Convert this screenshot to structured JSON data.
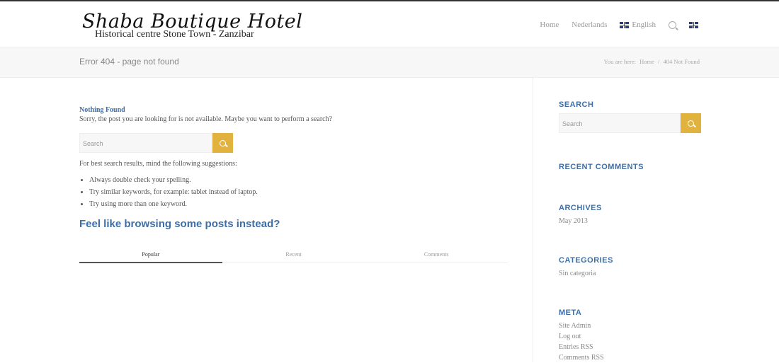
{
  "logo": {
    "title": "Shaba Boutique Hotel",
    "subtitle": "Historical centre Stone Town - Zanzibar"
  },
  "nav": {
    "home": "Home",
    "dutch": "Nederlands",
    "english": "English"
  },
  "titlebar": {
    "title": "Error 404 - page not found",
    "breadcrumb_label": "You are here:",
    "breadcrumb_home": "Home",
    "breadcrumb_sep": "/",
    "breadcrumb_current": "404 Not Found"
  },
  "main": {
    "heading": "Nothing Found",
    "message": "Sorry, the post you are looking for is not available. Maybe you want to perform a search?",
    "search_placeholder": "Search",
    "tips_intro": "For best search results, mind the following suggestions:",
    "tips": [
      "Always double check your spelling.",
      "Try similar keywords, for example: tablet instead of laptop.",
      "Try using more than one keyword."
    ],
    "browse_heading": "Feel like browsing some posts instead?",
    "tabs": [
      "Popular",
      "Recent",
      "Comments"
    ]
  },
  "sidebar": {
    "search_title": "SEARCH",
    "search_placeholder": "Search",
    "recent_comments_title": "RECENT COMMENTS",
    "archives_title": "ARCHIVES",
    "archives": [
      "May 2013"
    ],
    "categories_title": "CATEGORIES",
    "categories": [
      "Sin categoria"
    ],
    "meta_title": "META",
    "meta": [
      "Site Admin",
      "Log out",
      "Entries RSS",
      "Comments RSS"
    ]
  },
  "colors": {
    "accent": "#e1b33e",
    "link": "#3d6ea6"
  }
}
